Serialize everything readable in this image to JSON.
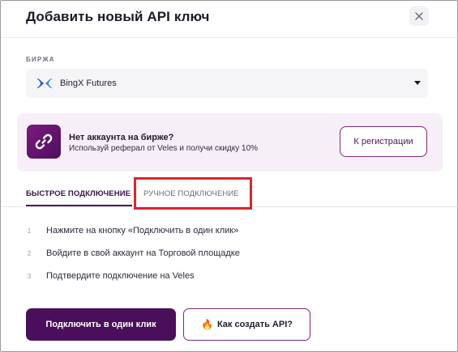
{
  "dialog": {
    "title": "Добавить новый API ключ",
    "close_icon": "close-icon"
  },
  "exchange": {
    "label": "БИРЖА",
    "selected": "BingX Futures",
    "logo_icon": "bingx-logo-icon",
    "brand_color": "#1b4fd6"
  },
  "promo": {
    "title": "Нет аккаунта на бирже?",
    "subtitle": "Используй реферал от Veles и получи скидку 10%",
    "button": "К регистрации",
    "icon": "link-icon",
    "icon_color": "#6b1676"
  },
  "tabs": [
    {
      "label": "БЫСТРОЕ ПОДКЛЮЧЕНИЕ",
      "active": true
    },
    {
      "label": "РУЧНОЕ ПОДКЛЮЧЕНИЕ",
      "active": false
    }
  ],
  "steps": [
    {
      "num": "1",
      "text": "Нажмите на кнопку «Подключить в один клик»"
    },
    {
      "num": "2",
      "text": "Войдите в свой аккаунт на Торговой площадке"
    },
    {
      "num": "3",
      "text": "Подтвердите подключение на Veles"
    }
  ],
  "actions": {
    "primary": "Подключить в один клик",
    "secondary": "Как создать API?",
    "secondary_icon": "fire-icon",
    "secondary_glyph": "🔥"
  },
  "colors": {
    "accent": "#4a0f5a",
    "highlight": "#d9262c",
    "promo_bg": "#f6eff7"
  }
}
